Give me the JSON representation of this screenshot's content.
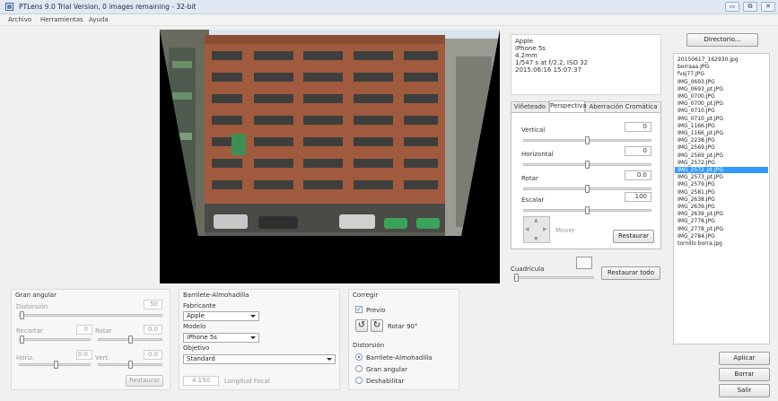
{
  "window": {
    "title": "PTLens 9.0 Trial Version, 0 images remaining - 32-bit",
    "controls": {
      "minimize": "▭",
      "maximize": "⧉",
      "close": "✕"
    }
  },
  "menu": [
    "Archivo",
    "Herramientas",
    "Ayuda"
  ],
  "exif": [
    "Apple",
    "iPhone 5s",
    "4.2mm",
    "1/547 s at f/2.2, ISO 32",
    "2015:06:16 15:07:37"
  ],
  "tabs": [
    "Viñeteado",
    "Perspectiva",
    "Aberración Cromática"
  ],
  "perspective": {
    "vertical_label": "Vertical",
    "vertical_value": "0",
    "horizontal_label": "Horizontal",
    "horizontal_value": "0",
    "rotate_label": "Rotar",
    "rotate_value": "0.0",
    "scale_label": "Escalar",
    "scale_value": "100",
    "move_label": "Mover",
    "restore_label": "Restaurar"
  },
  "grid": {
    "label": "Cuadrícula",
    "restore_all_label": "Restaurar todo"
  },
  "sidebar": {
    "directory_button": "Directorio...",
    "files": [
      "20150617_162930.jpg",
      "borraaa.JPG",
      "fvsj77.JPG",
      "IMG_0693.JPG",
      "IMG_0693_pt.JPG",
      "IMG_0700.JPG",
      "IMG_0700_pt.JPG",
      "IMG_0710.JPG",
      "IMG_0710_pt.JPG",
      "IMG_1166.JPG",
      "IMG_1166_pt.JPG",
      "IMG_2238.JPG",
      "IMG_2569.JPG",
      "IMG_2569_pt.JPG",
      "IMG_2572.JPG",
      "IMG_2572_pt.JPG",
      "IMG_2573_pt.JPG",
      "IMG_2579.JPG",
      "IMG_2581.JPG",
      "IMG_2638.JPG",
      "IMG_2639.JPG",
      "IMG_2639_pt.JPG",
      "IMG_2778.JPG",
      "IMG_2778_pt.JPG",
      "IMG_2784.JPG",
      "tornillo borra.jpg"
    ],
    "selected_file": "IMG_2572_pt.JPG",
    "apply_button": "Aplicar",
    "delete_button": "Borrar",
    "exit_button": "Salir"
  },
  "wide_angle": {
    "title": "Gran angular",
    "distortion_label": "Distorsión",
    "distortion_value": "50",
    "crop_label": "Recortar",
    "crop_value": "0",
    "rotate_label": "Rotar",
    "rotate_value": "0.0",
    "horiz_label": "Horiz.",
    "horiz_value": "0.0",
    "vert_label": "Vert.",
    "vert_value": "0.0",
    "restore_label": "Restaurar"
  },
  "barrel": {
    "title": "Barrilete-Almohadilla",
    "maker_label": "Fabricante",
    "maker_value": "Apple",
    "model_label": "Modelo",
    "model_value": "iPhone 5s",
    "lens_label": "Objetivo",
    "lens_value": "Standard",
    "focal_value": "4.150",
    "focal_label": "Longitud Focal"
  },
  "correct": {
    "title": "Corregir",
    "preview_label": "Previo",
    "rotate_label": "Rotar 90°",
    "distortion_title": "Distorsión",
    "options": [
      "Barrilete-Almohadilla",
      "Gran angular",
      "Deshabilitar"
    ],
    "selected": "Barrilete-Almohadilla"
  },
  "colors": {
    "selection": "#3399ff",
    "titlebar": "#dfe8f3"
  },
  "icons": {
    "rotate_left": "↺",
    "rotate_right": "↻",
    "check": "✓",
    "move_arrows": [
      "▲",
      "▼",
      "◀",
      "▶"
    ]
  }
}
